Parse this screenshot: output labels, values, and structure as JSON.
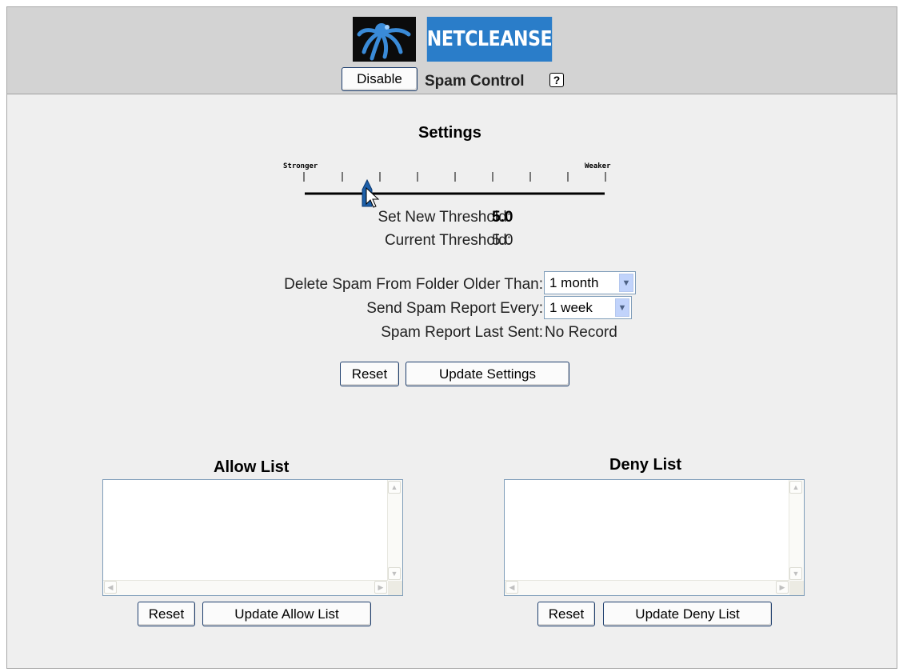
{
  "header": {
    "logo_text": "NETCLEANSE",
    "disable_label": "Disable",
    "title": "Spam Control",
    "help_glyph": "?"
  },
  "settings": {
    "heading": "Settings",
    "slider": {
      "left_label": "Stronger",
      "right_label": "Weaker",
      "tick_count": 9,
      "selected_tick": 1
    },
    "new_threshold_label": "Set New Threshold:",
    "new_threshold_value": "5.0",
    "current_threshold_label": "Current Threshold:",
    "current_threshold_value": "5.0",
    "delete_label": "Delete Spam From Folder Older Than:",
    "delete_value": "1 month",
    "report_label": "Send Spam Report Every:",
    "report_value": "1 week",
    "last_sent_label": "Spam Report Last Sent:",
    "last_sent_value": "No Record",
    "reset_label": "Reset",
    "update_label": "Update Settings"
  },
  "allow_list": {
    "heading": "Allow List",
    "reset_label": "Reset",
    "update_label": "Update Allow List"
  },
  "deny_list": {
    "heading": "Deny List",
    "reset_label": "Reset",
    "update_label": "Update Deny List"
  },
  "colors": {
    "logo_blue": "#2a7dc9",
    "slider_handle": "#1d5fa8",
    "header_gray": "#d3d3d3"
  }
}
